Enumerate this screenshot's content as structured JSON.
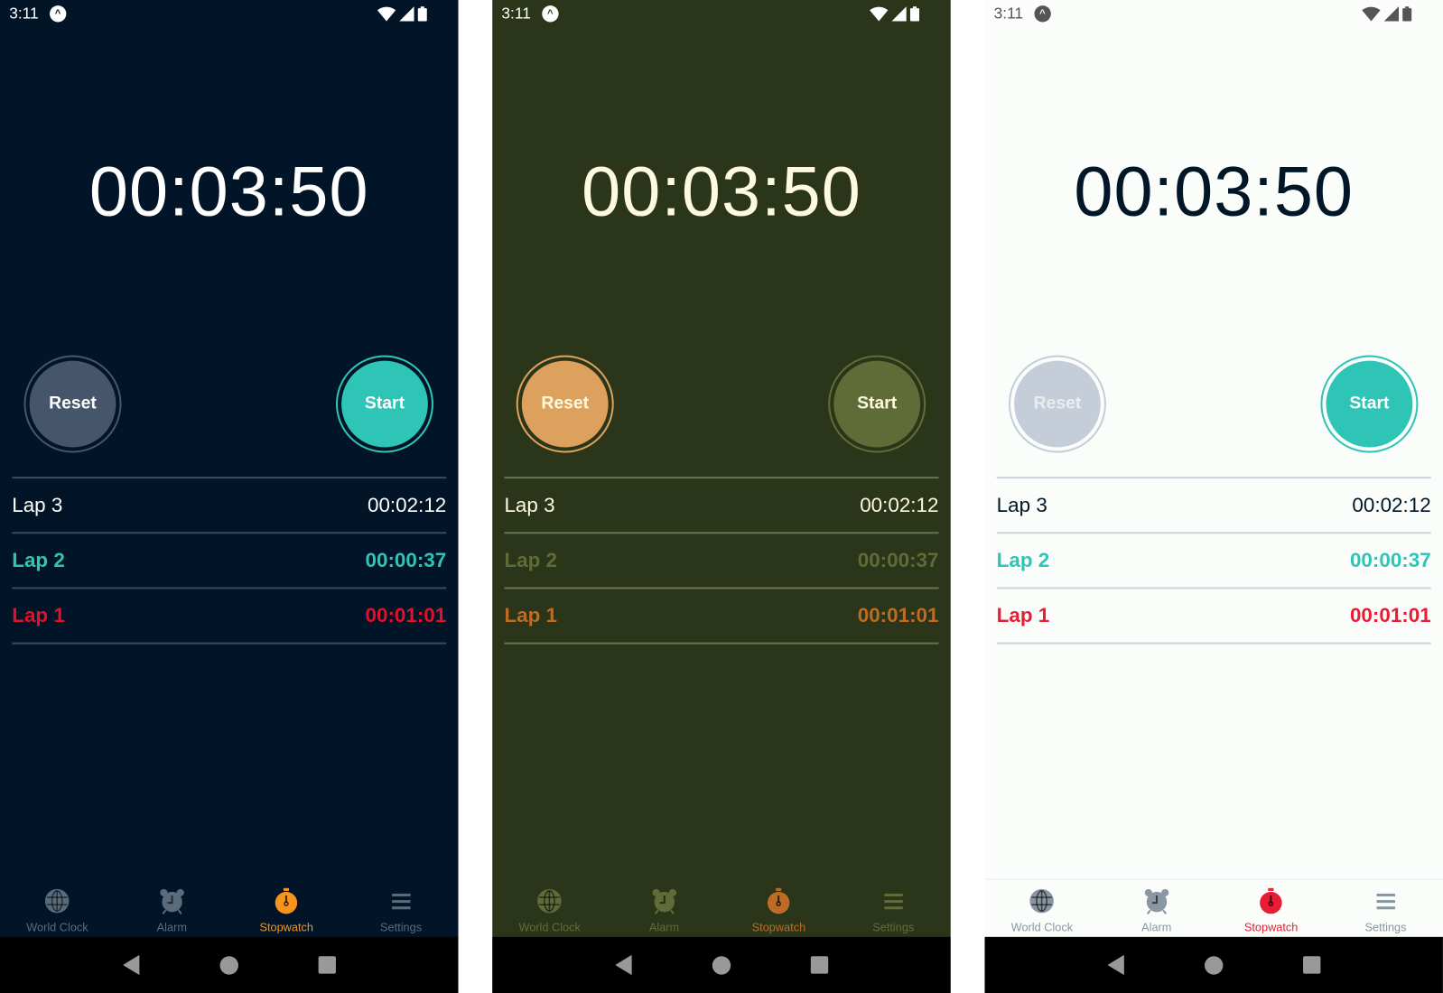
{
  "panels": [
    {
      "theme": "dark",
      "status_time": "3:11",
      "timer": "00:03:50",
      "reset_label": "Reset",
      "start_label": "Start",
      "laps": [
        {
          "label": "Lap 3",
          "time": "00:02:12",
          "kind": "normal"
        },
        {
          "label": "Lap 2",
          "time": "00:00:37",
          "kind": "fastest"
        },
        {
          "label": "Lap 1",
          "time": "00:01:01",
          "kind": "slowest"
        }
      ],
      "tabs": [
        {
          "label": "World Clock",
          "icon": "globe-icon"
        },
        {
          "label": "Alarm",
          "icon": "alarm-clock-icon"
        },
        {
          "label": "Stopwatch",
          "icon": "stopwatch-icon",
          "active": true
        },
        {
          "label": "Settings",
          "icon": "menu-icon"
        }
      ],
      "colors": {
        "bg": "#021427",
        "text": "#ffffff",
        "status": "#ffffff",
        "reset_fill": "#46566a",
        "reset_ring": "#46566a",
        "reset_text": "#ffffff",
        "start_fill": "#2ec4b6",
        "start_ring": "#2ec4b6",
        "start_text": "#ffffff",
        "fastest": "#2ec4b6",
        "slowest": "#e3102c",
        "divider": "#3b4b5c",
        "tab": "#5a6b7c",
        "active": "#f7941d",
        "tabbar_border": "transparent"
      }
    },
    {
      "theme": "olive",
      "status_time": "3:11",
      "timer": "00:03:50",
      "reset_label": "Reset",
      "start_label": "Start",
      "laps": [
        {
          "label": "Lap 3",
          "time": "00:02:12",
          "kind": "normal"
        },
        {
          "label": "Lap 2",
          "time": "00:00:37",
          "kind": "fastest"
        },
        {
          "label": "Lap 1",
          "time": "00:01:01",
          "kind": "slowest"
        }
      ],
      "tabs": [
        {
          "label": "World Clock",
          "icon": "globe-icon"
        },
        {
          "label": "Alarm",
          "icon": "alarm-clock-icon"
        },
        {
          "label": "Stopwatch",
          "icon": "stopwatch-icon",
          "active": true
        },
        {
          "label": "Settings",
          "icon": "menu-icon"
        }
      ],
      "colors": {
        "bg": "#2b3519",
        "text": "#fefae0",
        "status": "#ffffff",
        "reset_fill": "#dda15e",
        "reset_ring": "#dda15e",
        "reset_text": "#fefae0",
        "start_fill": "#606c38",
        "start_ring": "#606c38",
        "start_text": "#fefae0",
        "fastest": "#606c38",
        "slowest": "#bc6c25",
        "divider": "#6b7450",
        "tab": "#606c38",
        "active": "#bc6c25",
        "tabbar_border": "transparent"
      }
    },
    {
      "theme": "light",
      "status_time": "3:11",
      "timer": "00:03:50",
      "reset_label": "Reset",
      "start_label": "Start",
      "laps": [
        {
          "label": "Lap 3",
          "time": "00:02:12",
          "kind": "normal"
        },
        {
          "label": "Lap 2",
          "time": "00:00:37",
          "kind": "fastest"
        },
        {
          "label": "Lap 1",
          "time": "00:01:01",
          "kind": "slowest"
        }
      ],
      "tabs": [
        {
          "label": "World Clock",
          "icon": "globe-icon"
        },
        {
          "label": "Alarm",
          "icon": "alarm-clock-icon"
        },
        {
          "label": "Stopwatch",
          "icon": "stopwatch-icon",
          "active": true
        },
        {
          "label": "Settings",
          "icon": "menu-icon"
        }
      ],
      "colors": {
        "bg": "#fbfdfb",
        "text": "#011627",
        "status": "#555555",
        "reset_fill": "#c5ced8",
        "reset_ring": "#c5ced8",
        "reset_text": "#e9edf1",
        "start_fill": "#2ec4b6",
        "start_ring": "#2ec4b6",
        "start_text": "#ffffff",
        "fastest": "#2ec4b6",
        "slowest": "#e71d36",
        "divider": "#ccd3d9",
        "tab": "#8a96a3",
        "active": "#e71d36",
        "tabbar_border": "#e6eaee"
      }
    }
  ]
}
